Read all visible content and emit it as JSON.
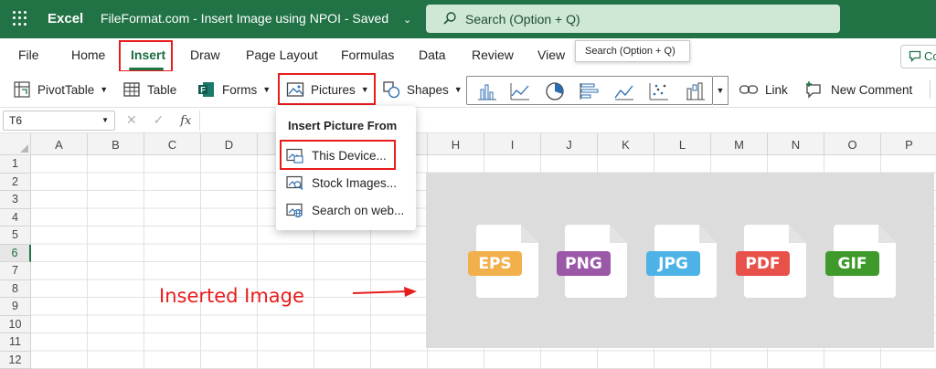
{
  "titlebar": {
    "app_name": "Excel",
    "document_title": "FileFormat.com - Insert Image using NPOI",
    "save_state": "Saved",
    "search_placeholder": "Search (Option + Q)",
    "background_color": "#217346"
  },
  "menu": {
    "tabs": [
      "File",
      "Home",
      "Insert",
      "Draw",
      "Page Layout",
      "Formulas",
      "Data",
      "Review",
      "View"
    ],
    "active_tab": "Insert",
    "tooltip": "Search (Option + Q)",
    "comments_label": "Co"
  },
  "ribbon": {
    "pivottable": "PivotTable",
    "table": "Table",
    "forms": "Forms",
    "pictures": "Pictures",
    "shapes": "Shapes",
    "link": "Link",
    "new_comment": "New Comment",
    "chart_gallery_icons": [
      "column-chart-icon",
      "line-chart-icon",
      "pie-chart-icon",
      "bar-chart-icon",
      "area-chart-icon",
      "scatter-chart-icon",
      "waterfall-chart-icon"
    ]
  },
  "formula_bar": {
    "name_box": "T6",
    "cancel_glyph": "✕",
    "enter_glyph": "✓",
    "fx_label": "fx",
    "formula_value": ""
  },
  "grid": {
    "columns": [
      "A",
      "B",
      "C",
      "D",
      "E",
      "F",
      "G",
      "H",
      "I",
      "J",
      "K",
      "L",
      "M",
      "N",
      "O",
      "P"
    ],
    "rows": [
      "1",
      "2",
      "3",
      "4",
      "5",
      "6",
      "7",
      "8",
      "9",
      "10",
      "11",
      "12"
    ],
    "selected_row": "6"
  },
  "pictures_menu": {
    "header": "Insert Picture From",
    "items": [
      "This Device...",
      "Stock Images...",
      "Search on web..."
    ]
  },
  "inserted_image": {
    "formats": [
      {
        "label": "EPS",
        "color": "#f2b04d"
      },
      {
        "label": "PNG",
        "color": "#9b57a8"
      },
      {
        "label": "JPG",
        "color": "#4db3e6"
      },
      {
        "label": "PDF",
        "color": "#e8514a"
      },
      {
        "label": "GIF",
        "color": "#3f9a2b"
      }
    ]
  },
  "annotation": {
    "text": "Inserted Image",
    "color": "#e81c1c"
  }
}
